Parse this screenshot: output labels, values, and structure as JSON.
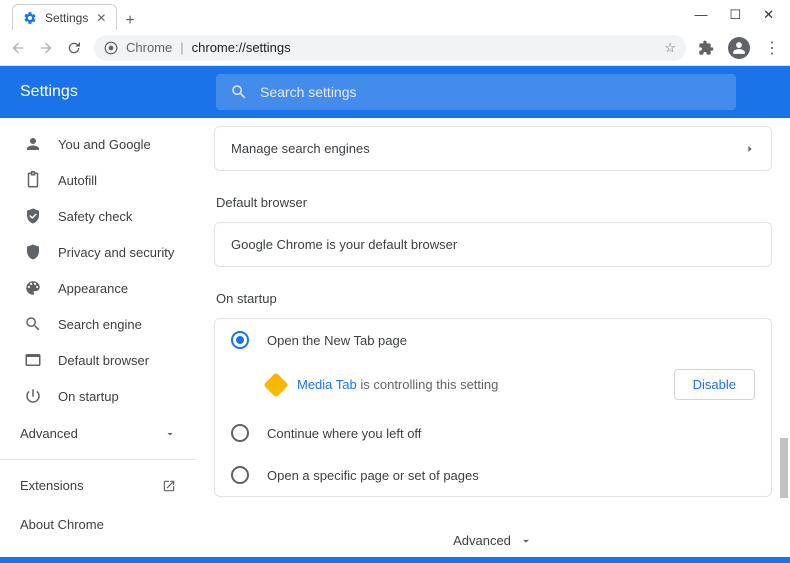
{
  "window": {
    "tab_title": "Settings",
    "url_prefix": "Chrome",
    "url_path": "chrome://settings"
  },
  "header": {
    "title": "Settings",
    "search_placeholder": "Search settings"
  },
  "sidebar": {
    "items": [
      {
        "label": "You and Google"
      },
      {
        "label": "Autofill"
      },
      {
        "label": "Safety check"
      },
      {
        "label": "Privacy and security"
      },
      {
        "label": "Appearance"
      },
      {
        "label": "Search engine"
      },
      {
        "label": "Default browser"
      },
      {
        "label": "On startup"
      }
    ],
    "advanced": "Advanced",
    "extensions": "Extensions",
    "about": "About Chrome"
  },
  "content": {
    "manage_search_engines": "Manage search engines",
    "default_browser_title": "Default browser",
    "default_browser_text": "Google Chrome is your default browser",
    "on_startup_title": "On startup",
    "startup_options": {
      "open_new_tab": "Open the New Tab page",
      "continue": "Continue where you left off",
      "specific": "Open a specific page or set of pages"
    },
    "controlled_by_prefix": "",
    "controlled_extension": "Media Tab",
    "controlled_suffix": " is controlling this setting",
    "disable": "Disable",
    "advanced": "Advanced"
  }
}
